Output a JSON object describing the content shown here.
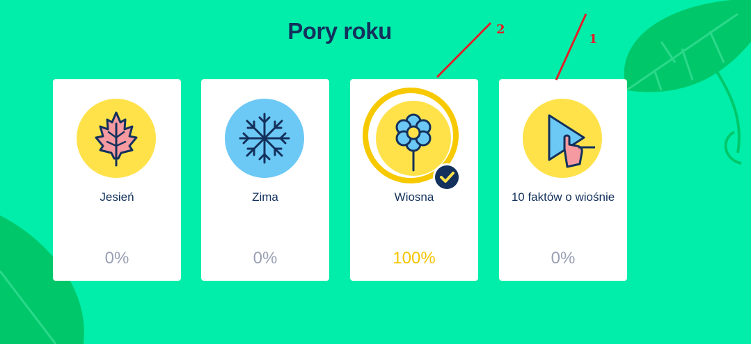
{
  "page": {
    "title": "Pory roku"
  },
  "cards": [
    {
      "name": "Jesień",
      "progress": "0%",
      "icon": "autumn-leaf-icon",
      "circle_color": "#ffe24a",
      "completed": false
    },
    {
      "name": "Zima",
      "progress": "0%",
      "icon": "snowflake-icon",
      "circle_color": "#6cc8f5",
      "completed": false
    },
    {
      "name": "Wiosna",
      "progress": "100%",
      "icon": "flower-icon",
      "circle_color": "#ffe24a",
      "completed": true
    },
    {
      "name": "10 faktów o wiośnie",
      "progress": "0%",
      "icon": "play-video-icon",
      "circle_color": "#ffe24a",
      "completed": false
    }
  ],
  "annotations": [
    {
      "label": "2"
    },
    {
      "label": "1"
    }
  ],
  "colors": {
    "background": "#00eeaa",
    "title": "#13315c",
    "progress_zero": "#9aa0b4",
    "progress_done": "#f5c400",
    "annotation": "#e0202a"
  }
}
